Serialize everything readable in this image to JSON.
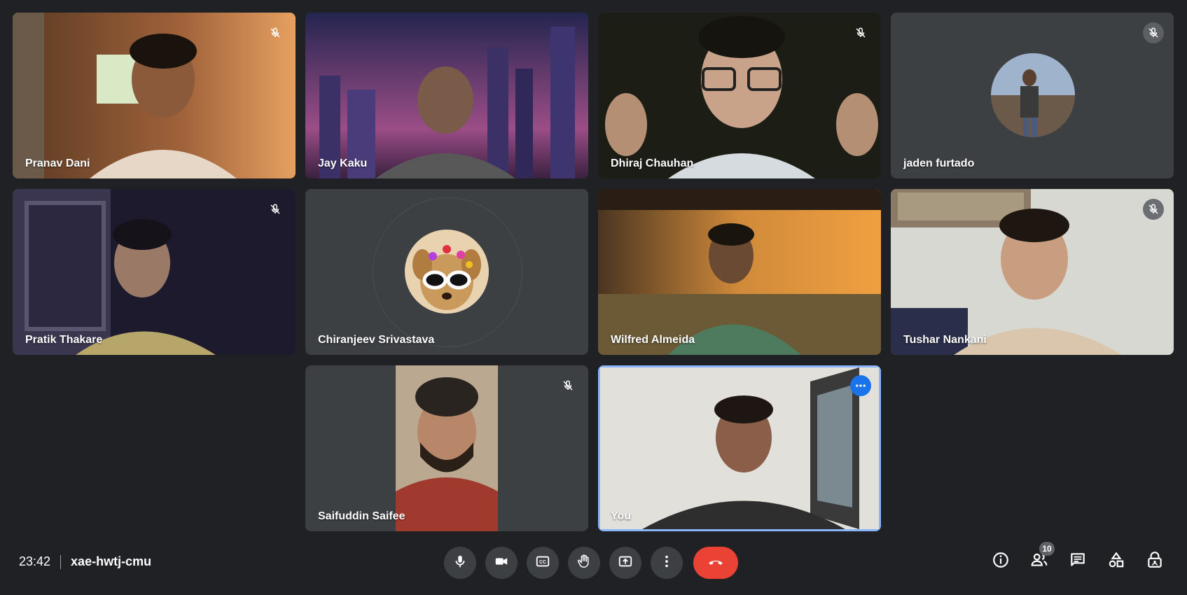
{
  "participants": [
    {
      "name": "Pranav Dani",
      "muted": true
    },
    {
      "name": "Jay Kaku",
      "muted": false
    },
    {
      "name": "Dhiraj Chauhan",
      "muted": true
    },
    {
      "name": "jaden furtado",
      "muted": true
    },
    {
      "name": "Pratik Thakare",
      "muted": true
    },
    {
      "name": "Chiranjeev Srivastava",
      "muted": false
    },
    {
      "name": "Wilfred Almeida",
      "muted": false
    },
    {
      "name": "Tushar Nankani",
      "muted": true
    },
    {
      "name": "Saifuddin Saifee",
      "muted": true
    },
    {
      "name": "You",
      "muted": false
    }
  ],
  "meeting": {
    "time": "23:42",
    "code": "xae-hwtj-cmu"
  },
  "controls": {
    "icons": [
      "mic-icon",
      "camera-icon",
      "captions-icon",
      "raise-hand-icon",
      "present-icon",
      "more-options-icon",
      "end-call-icon"
    ]
  },
  "side": {
    "people_count": "10"
  },
  "colors": {
    "end_call": "#ea4335",
    "self_border": "#8ab4f8",
    "more_button": "#1a73e8",
    "background": "#202124"
  }
}
